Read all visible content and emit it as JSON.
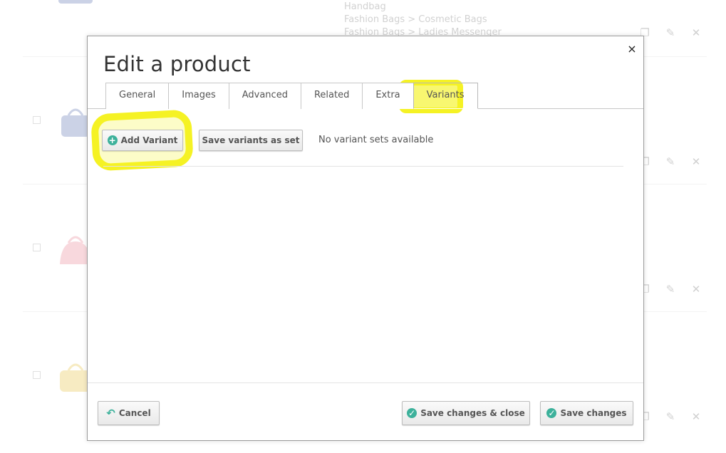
{
  "background": {
    "categories": [
      "Handbag",
      "Fashion Bags > Cosmetic Bags",
      "Fashion Bags > Ladies Messenger"
    ],
    "row_thumb_colors": [
      "#8e9cc9",
      "#8e9cc9",
      "#f0a9b6",
      "#eed47a"
    ],
    "actions": {
      "copy_icon": "copy-icon",
      "edit_icon": "pencil-icon",
      "delete_icon": "close-icon"
    }
  },
  "modal": {
    "title": "Edit a product",
    "close_glyph": "×",
    "tabs": [
      {
        "label": "General"
      },
      {
        "label": "Images"
      },
      {
        "label": "Advanced"
      },
      {
        "label": "Related"
      },
      {
        "label": "Extra"
      },
      {
        "label": "Variants",
        "active": true
      }
    ],
    "add_variant_label": "Add Variant",
    "add_variant_icon": "+",
    "save_set_label": "Save variants as set",
    "no_sets_text": "No variant sets available",
    "footer": {
      "cancel_label": "Cancel",
      "cancel_icon": "↶",
      "save_close_label": "Save changes & close",
      "save_label": "Save changes",
      "check_icon": "✓"
    }
  },
  "colors": {
    "accent": "#3db19b",
    "highlight": "#f5f224"
  }
}
